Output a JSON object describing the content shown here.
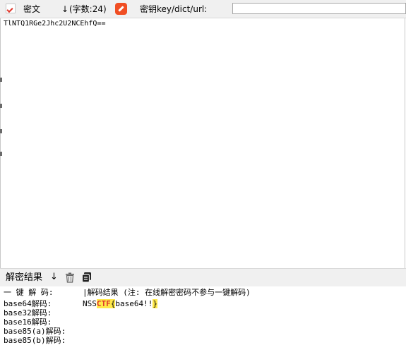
{
  "toolbar": {
    "cipher_label": "密文",
    "cipher_arrow": "↓",
    "cipher_count": "(字数:24)",
    "key_label": "密钥key/dict/url:",
    "key_value": ""
  },
  "cipher": {
    "text": "TlNTQ1RGe2Jhc2U2NCEhfQ=="
  },
  "result_bar": {
    "label": "解密结果",
    "arrow": "↓"
  },
  "results": {
    "onekey_label": "一 键 解 码:",
    "header": "|解码结果 (注: 在线解密密码不参与一键解码)",
    "rows": [
      "base64解码:",
      "base32解码:",
      "base16解码:",
      "base85(a)解码:",
      "base85(b)解码:"
    ],
    "flag_prefix": "NSS",
    "flag_highlight": "CTF",
    "flag_open": "{",
    "flag_body": "base64!!",
    "flag_close": "}"
  },
  "colors": {
    "highlight": "#ffe94a",
    "accent": "#e0372b",
    "edit_button": "#f04e23"
  },
  "icons": {
    "cipher": "download-arrow-icon",
    "edit": "pencil-icon",
    "trash": "trash-icon",
    "copy": "copy-icon"
  }
}
